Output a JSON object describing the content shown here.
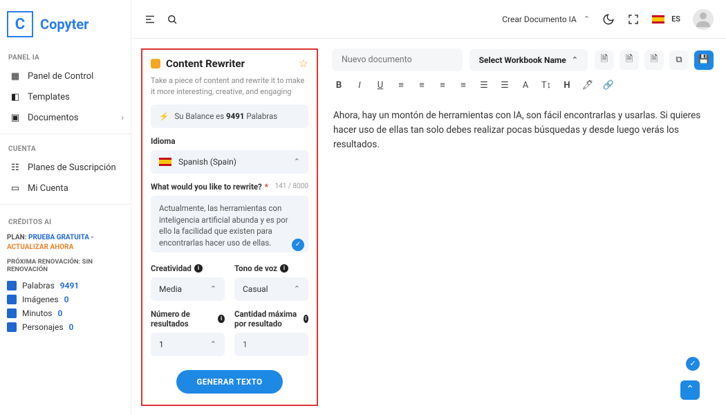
{
  "brand": {
    "letter": "C",
    "name": "Copyter"
  },
  "header": {
    "create_doc": "Crear Documento IA",
    "lang_code": "ES"
  },
  "sidebar": {
    "section_panel": "PANEL IA",
    "items_panel": [
      {
        "label": "Panel de Control"
      },
      {
        "label": "Templates"
      },
      {
        "label": "Documentos"
      }
    ],
    "section_account": "CUENTA",
    "items_account": [
      {
        "label": "Planes de Suscripción"
      },
      {
        "label": "Mi Cuenta"
      }
    ],
    "section_credits": "CRÉDITOS AI",
    "plan_prefix": "PLAN:",
    "plan_name": "PRUEBA GRATUITA",
    "plan_sep": "-",
    "plan_action": "ACTUALIZAR AHORA",
    "renew": "PRÓXIMA RENOVACIÓN: SIN RENOVACIÓN",
    "stats": [
      {
        "label": "Palabras",
        "value": "9491"
      },
      {
        "label": "Imágenes",
        "value": "0"
      },
      {
        "label": "Minutos",
        "value": "0"
      },
      {
        "label": "Personajes",
        "value": "0"
      }
    ]
  },
  "form": {
    "title": "Content Rewriter",
    "desc": "Take a piece of content and rewrite it to make it more interesting, creative, and engaging",
    "balance_pre": "Su Balance es",
    "balance_num": "9491",
    "balance_post": "Palabras",
    "lang_label": "Idioma",
    "lang_value": "Spanish (Spain)",
    "rewrite_label": "What would you like to rewrite?",
    "rewrite_count": "141 / 8000",
    "rewrite_value": "Actualmente, las herramientas con inteligencia artificial abunda y es por ello la facilidad que existen para encontrarlas hacer uso de ellas.",
    "creativity_label": "Creatividad",
    "creativity_value": "Media",
    "tone_label": "Tono de voz",
    "tone_value": "Casual",
    "results_label": "Número de resultados",
    "results_value": "1",
    "maxqty_label": "Cantidad máxima por resultado",
    "maxqty_value": "1",
    "submit": "GENERAR TEXTO"
  },
  "editor": {
    "doc_placeholder": "Nuevo documento",
    "workbook": "Select Workbook Name",
    "content": "Ahora, hay un montón de herramientas con IA, son fácil encontrarlas y usarlas. Si quieres hacer uso de ellas tan solo debes realizar pocas búsquedas y desde luego verás los resultados."
  }
}
